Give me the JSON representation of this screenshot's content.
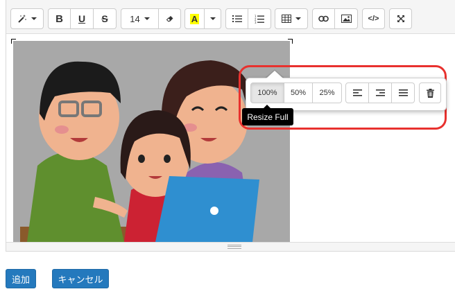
{
  "toolbar": {
    "font_size": "14",
    "bold_label": "B",
    "underline_label": "U",
    "strike_label": "S",
    "color_label": "A",
    "code_label": "</>"
  },
  "image_popover": {
    "resize_full": "100%",
    "resize_half": "50%",
    "resize_quarter": "25%",
    "tooltip": "Resize Full"
  },
  "actions": {
    "add_label": "追加",
    "cancel_label": "キャンセル"
  },
  "colors": {
    "highlight": "#e8312e",
    "primary_button": "#2479bd",
    "text_color_swatch": "#ffff00"
  },
  "icons": [
    "magic-wand-icon",
    "eraser-icon",
    "unordered-list-icon",
    "ordered-list-icon",
    "table-icon",
    "link-icon",
    "picture-icon",
    "code-icon",
    "fullscreen-icon",
    "align-left-icon",
    "align-right-icon",
    "justify-icon",
    "trash-icon"
  ]
}
